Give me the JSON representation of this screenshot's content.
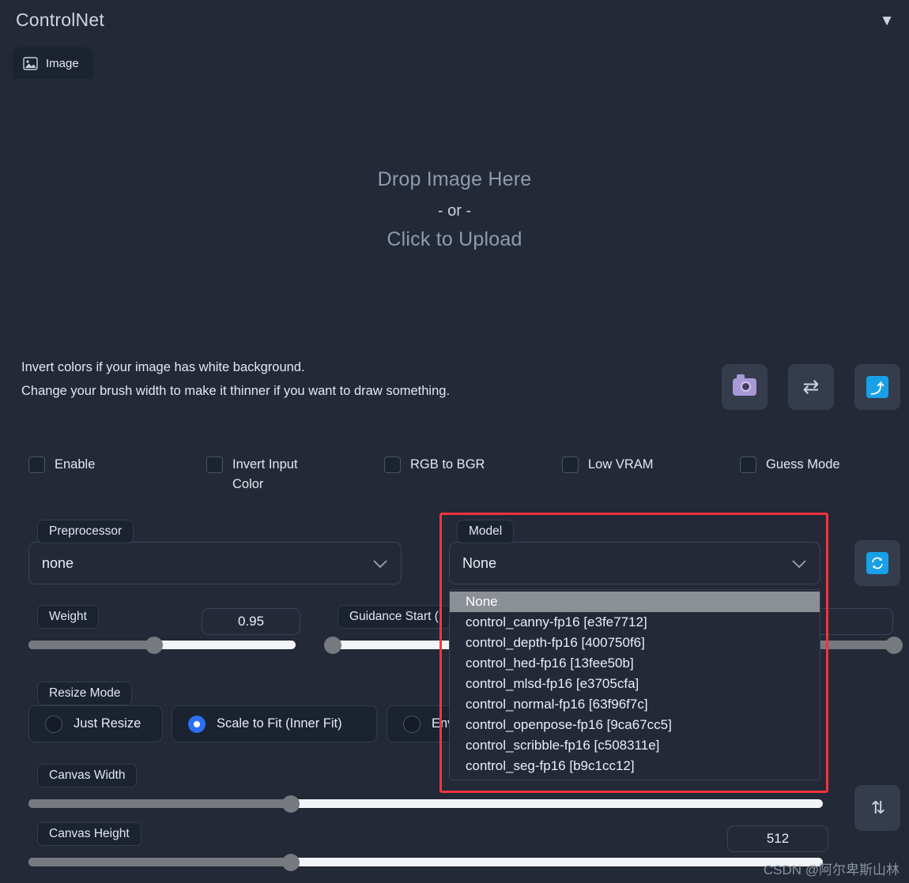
{
  "header": {
    "title": "ControlNet",
    "collapse_icon": "▼"
  },
  "tabs": [
    {
      "label": "Image",
      "icon": "image-icon"
    }
  ],
  "drop_area": {
    "line1": "Drop Image Here",
    "or": "- or -",
    "line2": "Click to Upload"
  },
  "info": {
    "line1": "Invert colors if your image has white background.",
    "line2": "Change your brush width to make it thinner if you want to draw something."
  },
  "image_tools": [
    {
      "name": "camera-button",
      "icon": "camera-icon"
    },
    {
      "name": "swap-button",
      "icon": "swap-arrows-icon",
      "glyph": "⇄"
    },
    {
      "name": "send-button",
      "icon": "arrow-up-right-icon",
      "glyph": "⤴"
    }
  ],
  "checkboxes": [
    {
      "label": "Enable",
      "checked": false
    },
    {
      "label": "Invert Input Color",
      "checked": false
    },
    {
      "label": "RGB to BGR",
      "checked": false
    },
    {
      "label": "Low VRAM",
      "checked": false
    },
    {
      "label": "Guess Mode",
      "checked": false
    }
  ],
  "preprocessor": {
    "label": "Preprocessor",
    "value": "none"
  },
  "model": {
    "label": "Model",
    "value": "None",
    "options": [
      "None",
      "control_canny-fp16 [e3fe7712]",
      "control_depth-fp16 [400750f6]",
      "control_hed-fp16 [13fee50b]",
      "control_mlsd-fp16 [e3705cfa]",
      "control_normal-fp16 [63f96f7c]",
      "control_openpose-fp16 [9ca67cc5]",
      "control_scribble-fp16 [c508311e]",
      "control_seg-fp16 [b9c1cc12]"
    ],
    "selected_index": 0,
    "highlight_color": "#f5333f"
  },
  "refresh_button": {
    "icon": "refresh-icon",
    "glyph": "🔄"
  },
  "sliders": {
    "weight": {
      "label": "Weight",
      "value": "0.95",
      "percent": 47
    },
    "guidance_start": {
      "label": "Guidance Start (",
      "value": "",
      "percent": 3
    },
    "guidance_end": {
      "label": "",
      "value": "1",
      "percent": 100
    },
    "canvas_width": {
      "label": "Canvas Width",
      "value": "",
      "percent": 33
    },
    "canvas_height": {
      "label": "Canvas Height",
      "value": "512",
      "percent": 33
    }
  },
  "resize_mode": {
    "label": "Resize Mode",
    "options": [
      {
        "label": "Just Resize",
        "selected": false
      },
      {
        "label": "Scale to Fit (Inner Fit)",
        "selected": true
      },
      {
        "label": "Env",
        "selected": false
      }
    ],
    "accent": "#2d6ef5"
  },
  "updown_button": {
    "icon": "up-down-arrows-icon",
    "glyph": "⇅"
  },
  "watermark": "CSDN @阿尔卑斯山林"
}
